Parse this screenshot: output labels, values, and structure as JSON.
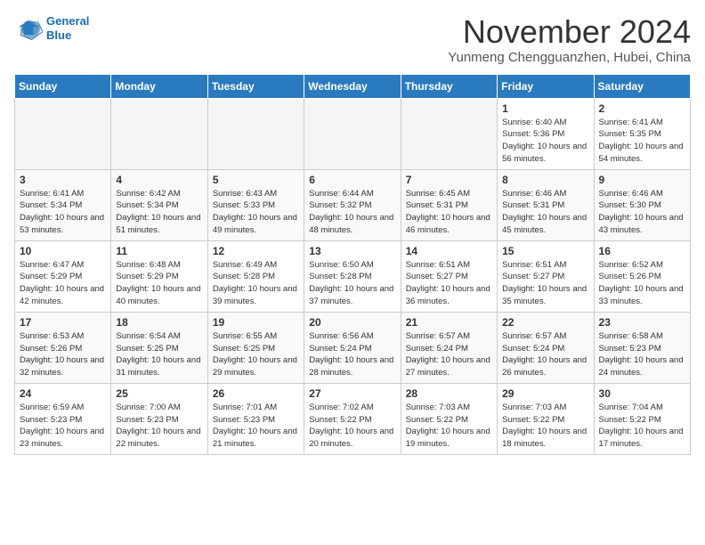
{
  "logo": {
    "line1": "General",
    "line2": "Blue"
  },
  "title": "November 2024",
  "subtitle": "Yunmeng Chengguanzhen, Hubei, China",
  "days_of_week": [
    "Sunday",
    "Monday",
    "Tuesday",
    "Wednesday",
    "Thursday",
    "Friday",
    "Saturday"
  ],
  "weeks": [
    [
      {
        "day": "",
        "info": ""
      },
      {
        "day": "",
        "info": ""
      },
      {
        "day": "",
        "info": ""
      },
      {
        "day": "",
        "info": ""
      },
      {
        "day": "",
        "info": ""
      },
      {
        "day": "1",
        "info": "Sunrise: 6:40 AM\nSunset: 5:36 PM\nDaylight: 10 hours\nand 56 minutes."
      },
      {
        "day": "2",
        "info": "Sunrise: 6:41 AM\nSunset: 5:35 PM\nDaylight: 10 hours\nand 54 minutes."
      }
    ],
    [
      {
        "day": "3",
        "info": "Sunrise: 6:41 AM\nSunset: 5:34 PM\nDaylight: 10 hours\nand 53 minutes."
      },
      {
        "day": "4",
        "info": "Sunrise: 6:42 AM\nSunset: 5:34 PM\nDaylight: 10 hours\nand 51 minutes."
      },
      {
        "day": "5",
        "info": "Sunrise: 6:43 AM\nSunset: 5:33 PM\nDaylight: 10 hours\nand 49 minutes."
      },
      {
        "day": "6",
        "info": "Sunrise: 6:44 AM\nSunset: 5:32 PM\nDaylight: 10 hours\nand 48 minutes."
      },
      {
        "day": "7",
        "info": "Sunrise: 6:45 AM\nSunset: 5:31 PM\nDaylight: 10 hours\nand 46 minutes."
      },
      {
        "day": "8",
        "info": "Sunrise: 6:46 AM\nSunset: 5:31 PM\nDaylight: 10 hours\nand 45 minutes."
      },
      {
        "day": "9",
        "info": "Sunrise: 6:46 AM\nSunset: 5:30 PM\nDaylight: 10 hours\nand 43 minutes."
      }
    ],
    [
      {
        "day": "10",
        "info": "Sunrise: 6:47 AM\nSunset: 5:29 PM\nDaylight: 10 hours\nand 42 minutes."
      },
      {
        "day": "11",
        "info": "Sunrise: 6:48 AM\nSunset: 5:29 PM\nDaylight: 10 hours\nand 40 minutes."
      },
      {
        "day": "12",
        "info": "Sunrise: 6:49 AM\nSunset: 5:28 PM\nDaylight: 10 hours\nand 39 minutes."
      },
      {
        "day": "13",
        "info": "Sunrise: 6:50 AM\nSunset: 5:28 PM\nDaylight: 10 hours\nand 37 minutes."
      },
      {
        "day": "14",
        "info": "Sunrise: 6:51 AM\nSunset: 5:27 PM\nDaylight: 10 hours\nand 36 minutes."
      },
      {
        "day": "15",
        "info": "Sunrise: 6:51 AM\nSunset: 5:27 PM\nDaylight: 10 hours\nand 35 minutes."
      },
      {
        "day": "16",
        "info": "Sunrise: 6:52 AM\nSunset: 5:26 PM\nDaylight: 10 hours\nand 33 minutes."
      }
    ],
    [
      {
        "day": "17",
        "info": "Sunrise: 6:53 AM\nSunset: 5:26 PM\nDaylight: 10 hours\nand 32 minutes."
      },
      {
        "day": "18",
        "info": "Sunrise: 6:54 AM\nSunset: 5:25 PM\nDaylight: 10 hours\nand 31 minutes."
      },
      {
        "day": "19",
        "info": "Sunrise: 6:55 AM\nSunset: 5:25 PM\nDaylight: 10 hours\nand 29 minutes."
      },
      {
        "day": "20",
        "info": "Sunrise: 6:56 AM\nSunset: 5:24 PM\nDaylight: 10 hours\nand 28 minutes."
      },
      {
        "day": "21",
        "info": "Sunrise: 6:57 AM\nSunset: 5:24 PM\nDaylight: 10 hours\nand 27 minutes."
      },
      {
        "day": "22",
        "info": "Sunrise: 6:57 AM\nSunset: 5:24 PM\nDaylight: 10 hours\nand 26 minutes."
      },
      {
        "day": "23",
        "info": "Sunrise: 6:58 AM\nSunset: 5:23 PM\nDaylight: 10 hours\nand 24 minutes."
      }
    ],
    [
      {
        "day": "24",
        "info": "Sunrise: 6:59 AM\nSunset: 5:23 PM\nDaylight: 10 hours\nand 23 minutes."
      },
      {
        "day": "25",
        "info": "Sunrise: 7:00 AM\nSunset: 5:23 PM\nDaylight: 10 hours\nand 22 minutes."
      },
      {
        "day": "26",
        "info": "Sunrise: 7:01 AM\nSunset: 5:23 PM\nDaylight: 10 hours\nand 21 minutes."
      },
      {
        "day": "27",
        "info": "Sunrise: 7:02 AM\nSunset: 5:22 PM\nDaylight: 10 hours\nand 20 minutes."
      },
      {
        "day": "28",
        "info": "Sunrise: 7:03 AM\nSunset: 5:22 PM\nDaylight: 10 hours\nand 19 minutes."
      },
      {
        "day": "29",
        "info": "Sunrise: 7:03 AM\nSunset: 5:22 PM\nDaylight: 10 hours\nand 18 minutes."
      },
      {
        "day": "30",
        "info": "Sunrise: 7:04 AM\nSunset: 5:22 PM\nDaylight: 10 hours\nand 17 minutes."
      }
    ]
  ]
}
